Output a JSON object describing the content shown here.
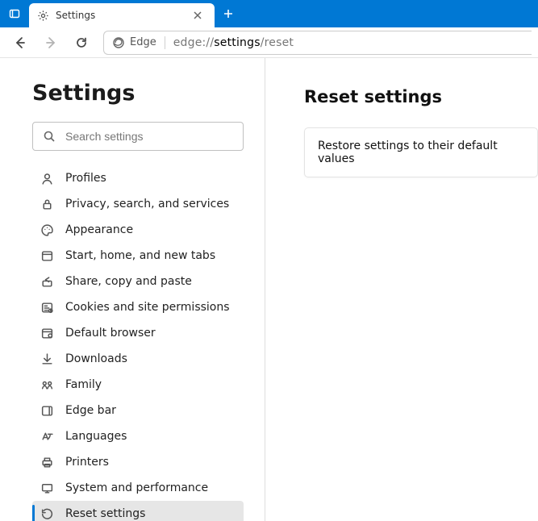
{
  "tab": {
    "title": "Settings"
  },
  "address": {
    "site_identity": "Edge",
    "url_prefix": "edge://",
    "url_bold": "settings",
    "url_suffix": "/reset"
  },
  "sidebar": {
    "title": "Settings",
    "search_placeholder": "Search settings",
    "items": [
      {
        "label": "Profiles"
      },
      {
        "label": "Privacy, search, and services"
      },
      {
        "label": "Appearance"
      },
      {
        "label": "Start, home, and new tabs"
      },
      {
        "label": "Share, copy and paste"
      },
      {
        "label": "Cookies and site permissions"
      },
      {
        "label": "Default browser"
      },
      {
        "label": "Downloads"
      },
      {
        "label": "Family"
      },
      {
        "label": "Edge bar"
      },
      {
        "label": "Languages"
      },
      {
        "label": "Printers"
      },
      {
        "label": "System and performance"
      },
      {
        "label": "Reset settings"
      }
    ]
  },
  "content": {
    "title": "Reset settings",
    "option1": "Restore settings to their default values"
  }
}
